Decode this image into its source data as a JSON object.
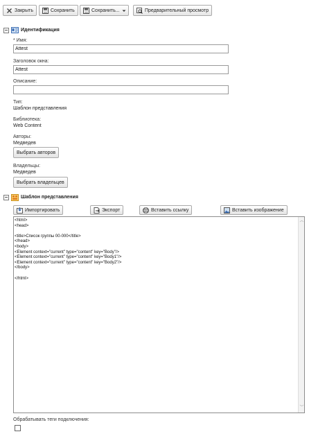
{
  "toolbar": {
    "close_label": "Закрыть",
    "save_label": "Сохранить",
    "save_as_label": "Сохранить...",
    "preview_label": "Предварительный просмотр"
  },
  "identification": {
    "title": "Идентификация",
    "name_label": "* Имя:",
    "name_value": "Attest",
    "window_title_label": "Заголовок окна:",
    "window_title_value": "Attest",
    "description_label": "Описание:",
    "description_value": "",
    "type_label": "Тип:",
    "type_value": "Шаблон представления",
    "library_label": "Библиотека:",
    "library_value": "Web Content",
    "authors_label": "Авторы:",
    "authors_value": "Медведев",
    "select_authors_label": "Выбрать авторов",
    "owners_label": "Владельцы:",
    "owners_value": "Медведев",
    "select_owners_label": "Выбрать владельцев"
  },
  "template": {
    "title": "Шаблон представления",
    "import_label": "Импортировать",
    "export_label": "Экспорт",
    "insert_link_label": "Вставить ссылку",
    "insert_image_label": "Вставить изображение",
    "code_lines": [
      "<html>",
      "<head>",
      "",
      "<title>Список группы 00-000</title>",
      "</head>",
      "<body>",
      "<Element context=\"current\" type=\"content\" key=\"Body\"/>",
      "<Element context=\"current\" type=\"content\" key=\"Body1\"/>",
      "<Element context=\"current\" type=\"content\" key=\"Body2\"/>",
      "</body>",
      "",
      "</html>"
    ],
    "process_tags_label": "Обрабатывать теги подключения:"
  },
  "icons": {
    "close": "close-icon",
    "save": "save-icon",
    "preview": "preview-icon",
    "identification": "identification-icon",
    "template": "template-icon",
    "import": "import-icon",
    "export": "export-icon",
    "link": "link-icon",
    "image": "image-icon"
  }
}
